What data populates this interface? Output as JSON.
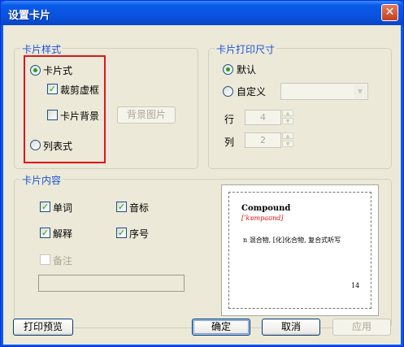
{
  "window": {
    "title": "设置卡片",
    "close_glyph": "✕"
  },
  "card_style": {
    "legend": "卡片样式",
    "card_mode_label": "卡片式",
    "cut_frame_label": "裁剪虚框",
    "card_bg_label": "卡片背景",
    "bg_image_button": "背景图片",
    "list_mode_label": "列表式",
    "card_mode_selected": true,
    "list_mode_selected": false,
    "cut_frame_checked": true,
    "card_bg_checked": false
  },
  "print_size": {
    "legend": "卡片打印尺寸",
    "default_label": "默认",
    "custom_label": "自定义",
    "default_selected": true,
    "row_label": "行",
    "row_value": "4",
    "col_label": "列",
    "col_value": "2"
  },
  "card_content": {
    "legend": "卡片内容",
    "word_label": "单词",
    "phonetic_label": "音标",
    "definition_label": "解释",
    "serial_label": "序号",
    "note_label": "备注",
    "word_checked": true,
    "phonetic_checked": true,
    "definition_checked": true,
    "serial_checked": true,
    "note_checked": false
  },
  "preview": {
    "word": "Compound",
    "phonetic": "[ˈkɒmpaʊnd]",
    "definition": "n 混合物, [化]化合物, 复合式听写",
    "number": "14"
  },
  "buttons": {
    "print_preview": "打印预览",
    "ok": "确定",
    "cancel": "取消",
    "apply": "应用"
  },
  "colors": {
    "accent": "#1a52d6",
    "highlight": "#e0151b",
    "check": "#21a121"
  }
}
